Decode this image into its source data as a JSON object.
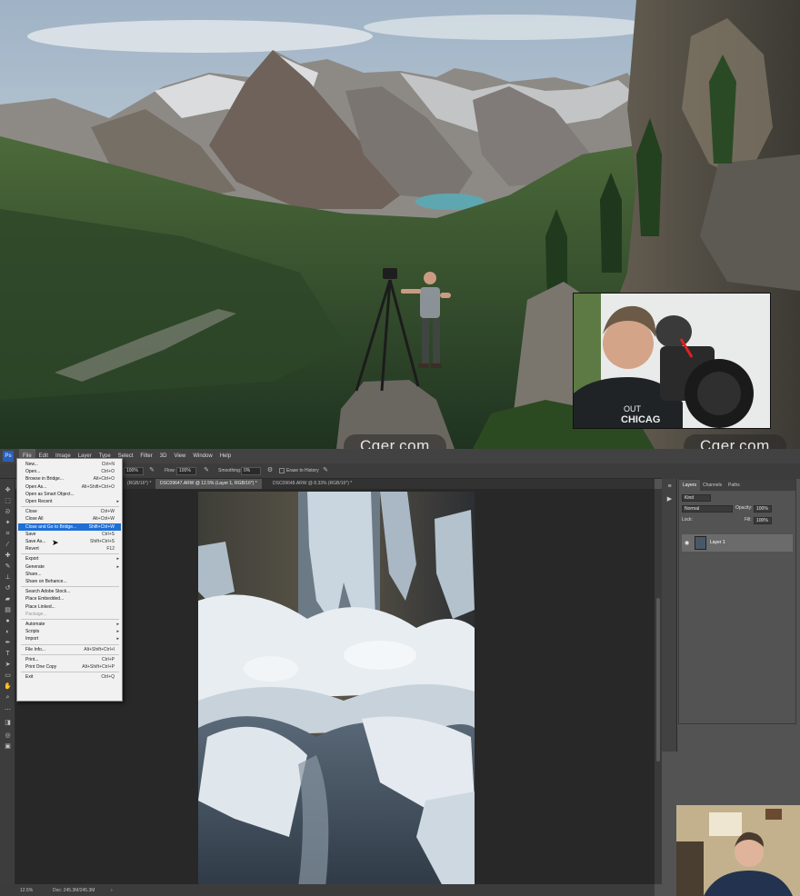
{
  "watermarks": [
    "Cger.com",
    "Cger.com"
  ],
  "menubar": {
    "logo": "Ps",
    "items": [
      "File",
      "Edit",
      "Image",
      "Layer",
      "Type",
      "Select",
      "Filter",
      "3D",
      "View",
      "Window",
      "Help"
    ]
  },
  "optbar": {
    "zoom_value": "100%",
    "flow_label": "Flow:",
    "flow_value": "100%",
    "smoothing_label": "Smoothing:",
    "smoothing_value": "0%",
    "erase_history": "Erase to History"
  },
  "tabs": [
    {
      "label": "(RGB/16*) *",
      "active": false
    },
    {
      "label": "DSC09647.ARW @ 12.5% (Layer 1, RGB/16*) *",
      "active": true
    },
    {
      "label": "DSC09648.ARW @ 8.33% (RGB/16*) *",
      "active": false
    }
  ],
  "file_menu": [
    {
      "label": "New...",
      "shortcut": "Ctrl+N"
    },
    {
      "label": "Open...",
      "shortcut": "Ctrl+O"
    },
    {
      "label": "Browse in Bridge...",
      "shortcut": "Alt+Ctrl+O"
    },
    {
      "label": "Open As...",
      "shortcut": "Alt+Shift+Ctrl+O"
    },
    {
      "label": "Open as Smart Object...",
      "shortcut": ""
    },
    {
      "label": "Open Recent",
      "shortcut": "",
      "submenu": true
    },
    {
      "sep": true
    },
    {
      "label": "Close",
      "shortcut": "Ctrl+W"
    },
    {
      "label": "Close All",
      "shortcut": "Alt+Ctrl+W"
    },
    {
      "label": "Close and Go to Bridge...",
      "shortcut": "Shift+Ctrl+W",
      "highlight": true
    },
    {
      "label": "Save",
      "shortcut": "Ctrl+S"
    },
    {
      "label": "Save As...",
      "shortcut": "Shift+Ctrl+S"
    },
    {
      "label": "Revert",
      "shortcut": "F12"
    },
    {
      "sep": true
    },
    {
      "label": "Export",
      "shortcut": "",
      "submenu": true
    },
    {
      "label": "Generate",
      "shortcut": "",
      "submenu": true
    },
    {
      "label": "Share...",
      "shortcut": ""
    },
    {
      "label": "Share on Behance...",
      "shortcut": ""
    },
    {
      "sep": true
    },
    {
      "label": "Search Adobe Stock...",
      "shortcut": ""
    },
    {
      "label": "Place Embedded...",
      "shortcut": ""
    },
    {
      "label": "Place Linked...",
      "shortcut": ""
    },
    {
      "label": "Package...",
      "shortcut": "",
      "disabled": true
    },
    {
      "sep": true
    },
    {
      "label": "Automate",
      "shortcut": "",
      "submenu": true
    },
    {
      "label": "Scripts",
      "shortcut": "",
      "submenu": true
    },
    {
      "label": "Import",
      "shortcut": "",
      "submenu": true
    },
    {
      "sep": true
    },
    {
      "label": "File Info...",
      "shortcut": "Alt+Shift+Ctrl+I"
    },
    {
      "sep": true
    },
    {
      "label": "Print...",
      "shortcut": "Ctrl+P"
    },
    {
      "label": "Print One Copy",
      "shortcut": "Alt+Shift+Ctrl+P"
    },
    {
      "sep": true
    },
    {
      "label": "Exit",
      "shortcut": "Ctrl+Q"
    }
  ],
  "layers_panel": {
    "tabs": [
      "Layers",
      "Channels",
      "Paths"
    ],
    "filter_kind": "Kind",
    "blend_mode": "Normal",
    "opacity_label": "Opacity:",
    "opacity_value": "100%",
    "lock_label": "Lock:",
    "fill_label": "Fill:",
    "fill_value": "100%",
    "layer_name": "Layer 1"
  },
  "status": {
    "zoom": "12.5%",
    "doc": "Doc: 245.3M/245.3M"
  },
  "colors": {
    "ps_bg": "#535353",
    "menu_highlight": "#1f6fd4"
  }
}
